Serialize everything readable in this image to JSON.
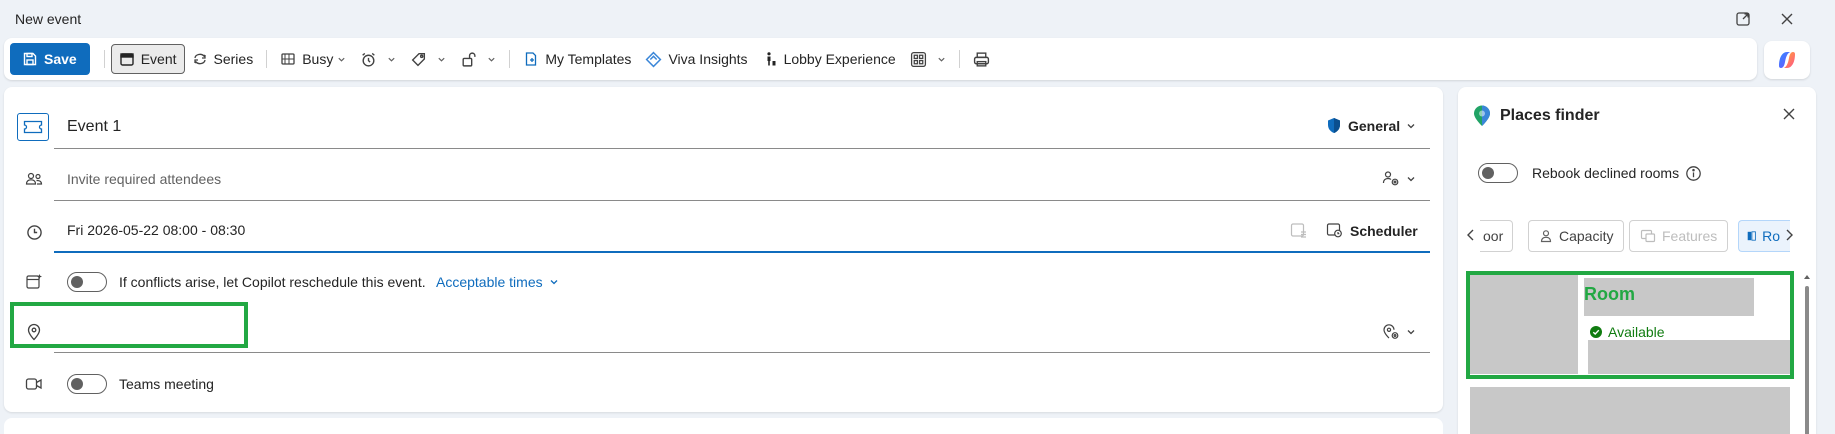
{
  "window": {
    "title": "New event"
  },
  "toolbar": {
    "save": "Save",
    "event": "Event",
    "series": "Series",
    "busy": "Busy",
    "my_templates": "My Templates",
    "viva_insights": "Viva Insights",
    "lobby_experience": "Lobby Experience"
  },
  "form": {
    "title_value": "Event 1",
    "sensitivity": "General",
    "attendees_placeholder": "Invite required attendees",
    "datetime_value": "Fri 2026-05-22 08:00 - 08:30",
    "scheduler": "Scheduler",
    "copilot_reschedule_label": "If conflicts arise, let Copilot reschedule this event.",
    "acceptable_times": "Acceptable times",
    "location_value": "",
    "teams_meeting": "Teams meeting"
  },
  "places_finder": {
    "title": "Places finder",
    "rebook_label": "Rebook declined rooms",
    "filters": [
      {
        "label": "oor",
        "state": "normal"
      },
      {
        "label": "Capacity",
        "state": "normal"
      },
      {
        "label": "Features",
        "state": "disabled"
      },
      {
        "label": "Ro",
        "state": "selected"
      }
    ],
    "room": {
      "name": "Room",
      "status": "Available"
    }
  },
  "colors": {
    "brand": "#0f6cbd",
    "highlight": "#22a843",
    "available": "#107c10"
  }
}
